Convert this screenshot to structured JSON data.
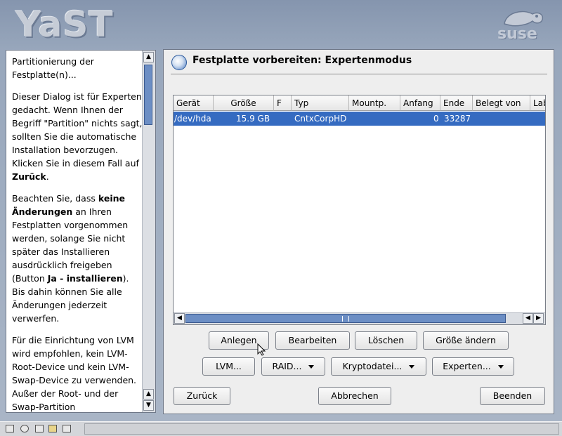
{
  "branding": {
    "yast": "YaST",
    "suse": "suse"
  },
  "dialog": {
    "title": "Festplatte vorbereiten: Expertenmodus"
  },
  "help": {
    "p1": "Partitionierung der Festplatte(n)...",
    "p2_text": "Dieser Dialog ist für Experten gedacht. Wenn Ihnen der Begriff \"Partition\" nichts sagt, sollten Sie die automatische Installation bevorzugen. Klicken Sie in diesem Fall auf ",
    "p2_bold": "Zurück",
    "p2_end": ".",
    "p3_a": "Beachten Sie, dass ",
    "p3_bold1": "keine Änderungen",
    "p3_b": " an Ihren Festplatten vorgenommen werden, solange Sie nicht später das Installieren ausdrücklich freigeben (Button ",
    "p3_bold2": "Ja - installieren",
    "p3_c": "). Bis dahin können Sie alle Änderungen jederzeit verwerfen.",
    "p4": "Für die Einrichtung von LVM wird empfohlen, kein LVM-Root-Device und kein LVM-Swap-Device zu verwenden. Außer der Root- und der Swap-Partition"
  },
  "table": {
    "columns": [
      "Gerät",
      "Größe",
      "F",
      "Typ",
      "Mountp.",
      "Anfang",
      "Ende",
      "Belegt von",
      "Lab"
    ],
    "rows": [
      {
        "device": "/dev/hda",
        "size": "15.9 GB",
        "f": "",
        "type": "CntxCorpHD",
        "mount": "",
        "start": "0",
        "end": "33287",
        "used_by": "",
        "label": ""
      }
    ]
  },
  "buttons": {
    "create": "Anlegen",
    "edit": "Bearbeiten",
    "delete": "Löschen",
    "resize": "Größe ändern",
    "lvm": "LVM...",
    "raid": "RAID...",
    "crypt": "Kryptodatei...",
    "expert": "Experten...",
    "back": "Zurück",
    "abort": "Abbrechen",
    "finish": "Beenden"
  }
}
